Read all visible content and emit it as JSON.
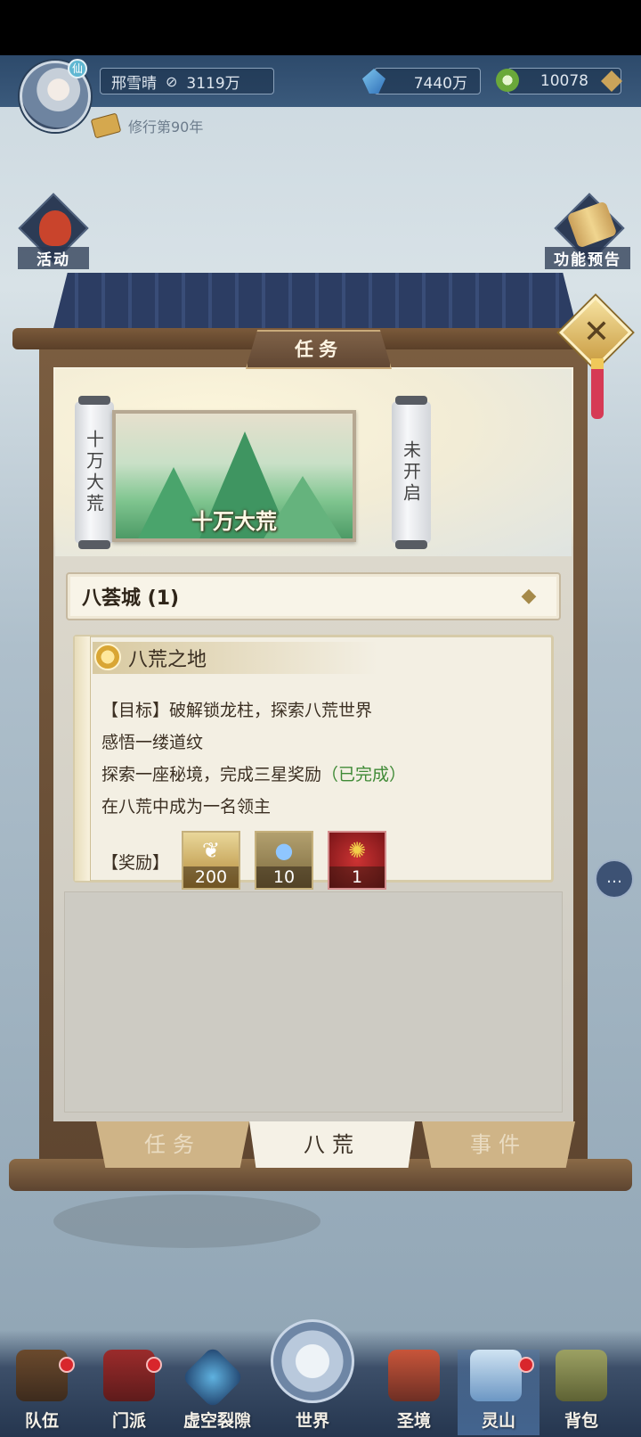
{
  "player": {
    "name": "邢雪晴",
    "power": "3119万",
    "cultivation": "修行第90年"
  },
  "currencies": {
    "crystal": "7440万",
    "jade": "10078"
  },
  "side_buttons": {
    "activity": "活动",
    "feature_preview": "功能预告"
  },
  "panel": {
    "title": "任务",
    "scroll_left": "十万大荒",
    "scroll_right": "未开启",
    "banner_label": "十万大荒",
    "section_header": "八荟城 (1)",
    "quest": {
      "title": "八荒之地",
      "goal": "【目标】破解锁龙柱，探索八荒世界",
      "line2": "感悟一缕道纹",
      "line3_main": "探索一座秘境，完成三星奖励",
      "line3_status": "（已完成）",
      "line4": "在八荒中成为一名领主",
      "rewards_label": "【奖励】",
      "rewards": [
        {
          "icon": "feather-icon",
          "count": "200"
        },
        {
          "icon": "orb-icon",
          "count": "10"
        },
        {
          "icon": "golden-bird-icon",
          "count": "1"
        }
      ]
    },
    "tabs": [
      "任务",
      "八荒",
      "事件"
    ]
  },
  "bottom_nav": [
    "队伍",
    "门派",
    "虚空裂隙",
    "世界",
    "圣境",
    "灵山",
    "背包"
  ],
  "colors": {
    "completed": "#3f8a36",
    "notification": "#d8262c",
    "frame_wood": "#6b5038"
  }
}
